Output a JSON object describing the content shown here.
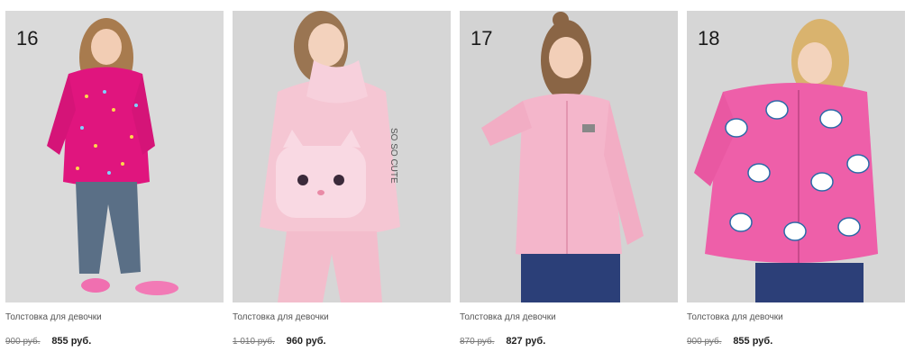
{
  "products": [
    {
      "number": "16",
      "title": "Толстовка для девочки",
      "old_price": "900 руб.",
      "price": "855 руб.",
      "colors": {
        "bg": "#dadada",
        "top": "#e0157e",
        "bottom": "#5a6f86"
      }
    },
    {
      "number": "",
      "title": "Толстовка для девочки",
      "old_price": "1 010 руб.",
      "price": "960 руб.",
      "colors": {
        "bg": "#d6d6d6",
        "top": "#f5c6d3",
        "bottom": "#f3bdcc"
      }
    },
    {
      "number": "17",
      "title": "Толстовка для девочки",
      "old_price": "870 руб.",
      "price": "827 руб.",
      "colors": {
        "bg": "#d3d3d3",
        "top": "#f4b6cb",
        "bottom": "#2b3f78"
      }
    },
    {
      "number": "18",
      "title": "Толстовка для девочки",
      "old_price": "900 руб.",
      "price": "855 руб.",
      "colors": {
        "bg": "#d6d6d6",
        "top": "#ee5fa9",
        "bottom": "#2c3f78"
      }
    }
  ]
}
